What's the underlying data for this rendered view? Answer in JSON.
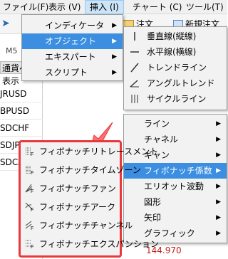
{
  "menubar": {
    "items": [
      {
        "label": "ファイル(F)"
      },
      {
        "label": "表示 (V)"
      },
      {
        "label": "挿入 (I)"
      },
      {
        "label": "チャート (C)"
      },
      {
        "label": "ツール(T)"
      }
    ]
  },
  "toolbar": {
    "label1": "注文",
    "label2": "新規注文"
  },
  "watchlist": {
    "timeframe": "M5",
    "header": "通貨ペア表示",
    "symbols": [
      "JRUSD",
      "BPUSD",
      "SDCHF",
      "SDJPY",
      "SDCAD"
    ]
  },
  "insert_menu": {
    "items": [
      "インディケータ",
      "オブジェクト",
      "エキスパート",
      "スクリプト"
    ]
  },
  "objects_menu": {
    "items": [
      "垂直線(縦線)",
      "水平線(横線)",
      "トレンドライン",
      "アングルトレンド",
      "サイクルライン"
    ]
  },
  "object_categories": {
    "items": [
      "ライン",
      "チャネル",
      "ギャン",
      "フィボナッチ係数",
      "エリオット波動",
      "図形",
      "矢印",
      "グラフィック"
    ]
  },
  "fibonacci_menu": {
    "items": [
      "フィボナッチリトレースメント",
      "フィボナッチタイムゾーン",
      "フィボナッチファン",
      "フィボナッチアーク",
      "フィボナッチチャンネル",
      "フィボナッチエクスパンション"
    ]
  },
  "prices": {
    "value": "144.970"
  },
  "colors": {
    "highlight": "#3b8ee0",
    "callout": "#e8393d"
  }
}
